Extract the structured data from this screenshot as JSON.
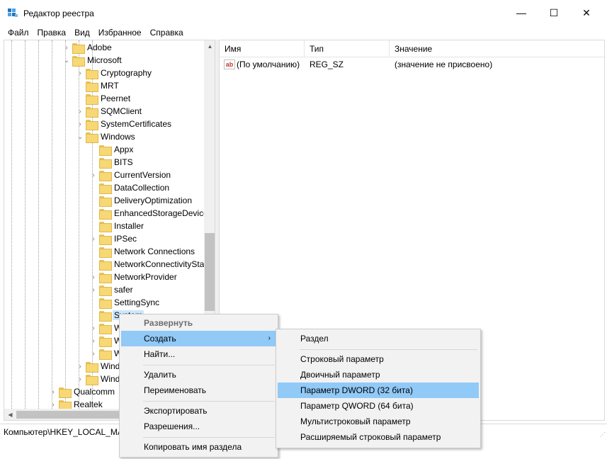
{
  "window": {
    "title": "Редактор реестра",
    "controls": {
      "minimize": "—",
      "maximize": "☐",
      "close": "✕"
    }
  },
  "menu": [
    "Файл",
    "Правка",
    "Вид",
    "Избранное",
    "Справка"
  ],
  "tree": {
    "rows": [
      {
        "label": "Adobe",
        "level": 4,
        "expander": "›"
      },
      {
        "label": "Microsoft",
        "level": 4,
        "expander": "⌄"
      },
      {
        "label": "Cryptography",
        "level": 5,
        "expander": "›"
      },
      {
        "label": "MRT",
        "level": 5,
        "expander": ""
      },
      {
        "label": "Peernet",
        "level": 5,
        "expander": ""
      },
      {
        "label": "SQMClient",
        "level": 5,
        "expander": "›"
      },
      {
        "label": "SystemCertificates",
        "level": 5,
        "expander": "›"
      },
      {
        "label": "Windows",
        "level": 5,
        "expander": "⌄"
      },
      {
        "label": "Appx",
        "level": 6,
        "expander": ""
      },
      {
        "label": "BITS",
        "level": 6,
        "expander": ""
      },
      {
        "label": "CurrentVersion",
        "level": 6,
        "expander": "›"
      },
      {
        "label": "DataCollection",
        "level": 6,
        "expander": ""
      },
      {
        "label": "DeliveryOptimization",
        "level": 6,
        "expander": ""
      },
      {
        "label": "EnhancedStorageDevices",
        "level": 6,
        "expander": ""
      },
      {
        "label": "Installer",
        "level": 6,
        "expander": ""
      },
      {
        "label": "IPSec",
        "level": 6,
        "expander": "›"
      },
      {
        "label": "Network Connections",
        "level": 6,
        "expander": ""
      },
      {
        "label": "NetworkConnectivityStatusIndicator",
        "level": 6,
        "expander": ""
      },
      {
        "label": "NetworkProvider",
        "level": 6,
        "expander": "›"
      },
      {
        "label": "safer",
        "level": 6,
        "expander": "›"
      },
      {
        "label": "SettingSync",
        "level": 6,
        "expander": ""
      },
      {
        "label": "System",
        "level": 6,
        "expander": "",
        "selected": true
      },
      {
        "label": "WcmSvc",
        "level": 6,
        "expander": "›"
      },
      {
        "label": "WindowsUpdate",
        "level": 6,
        "expander": "›"
      },
      {
        "label": "WorkplaceJoin",
        "level": 6,
        "expander": "›"
      },
      {
        "label": "Windows Advanced Threat Protection",
        "level": 5,
        "expander": "›"
      },
      {
        "label": "Windows Defender",
        "level": 5,
        "expander": "›"
      },
      {
        "label": "Qualcomm",
        "level": 3,
        "expander": "›"
      },
      {
        "label": "Realtek",
        "level": 3,
        "expander": "›"
      }
    ]
  },
  "values": {
    "columns": {
      "name": "Имя",
      "type": "Тип",
      "value": "Значение"
    },
    "rows": [
      {
        "icon": "ab",
        "name": "(По умолчанию)",
        "type": "REG_SZ",
        "value": "(значение не присвоено)"
      }
    ]
  },
  "status": {
    "path": "Компьютер\\HKEY_LOCAL_MACHINE\\SOFTWARE\\Policies\\Microsoft\\Windows\\System"
  },
  "context_menu": {
    "items": [
      {
        "label": "Развернуть",
        "disabled": true
      },
      {
        "label": "Создать",
        "highlighted": true,
        "submenu_arrow": "›"
      },
      {
        "label": "Найти..."
      },
      {
        "label": "Удалить"
      },
      {
        "label": "Переименовать"
      },
      {
        "label": "Экспортировать"
      },
      {
        "label": "Разрешения..."
      },
      {
        "label": "Копировать имя раздела"
      }
    ]
  },
  "submenu": {
    "items": [
      {
        "label": "Раздел"
      },
      {
        "label": "Строковый параметр"
      },
      {
        "label": "Двоичный параметр"
      },
      {
        "label": "Параметр DWORD (32 бита)",
        "highlighted": true
      },
      {
        "label": "Параметр QWORD (64 бита)"
      },
      {
        "label": "Мультистроковый параметр"
      },
      {
        "label": "Расширяемый строковый параметр"
      }
    ]
  }
}
